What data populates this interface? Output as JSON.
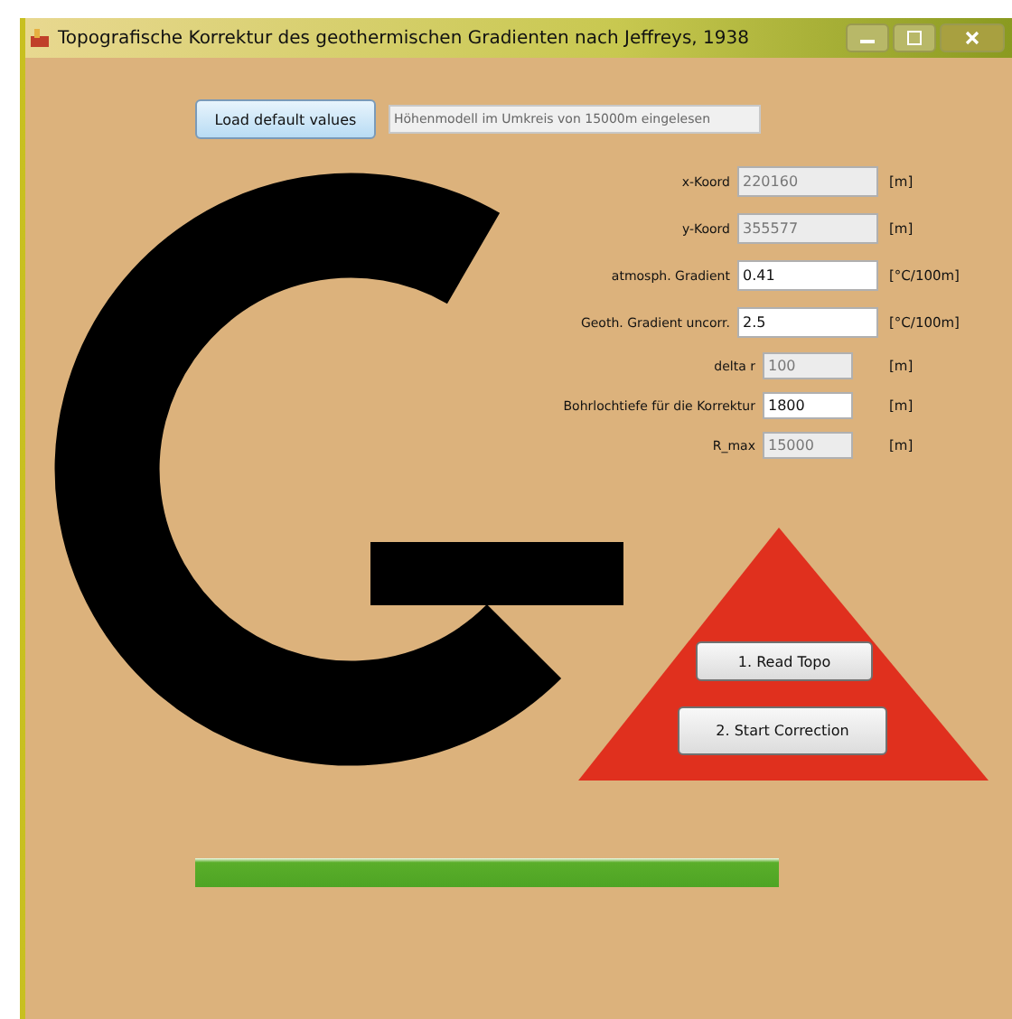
{
  "window": {
    "title": "Topografische Korrektur des geothermischen Gradienten nach Jeffreys, 1938"
  },
  "load_button": {
    "label": "Load default values"
  },
  "status_field": {
    "value": "Höhenmodell im Umkreis von 15000m eingelesen",
    "disabled": true
  },
  "fields": [
    {
      "label": "x-Koord",
      "value": "220160",
      "unit": "[m]",
      "disabled": true,
      "wide": true
    },
    {
      "label": "y-Koord",
      "value": "355577",
      "unit": "[m]",
      "disabled": true,
      "wide": true
    },
    {
      "label": "atmosph. Gradient",
      "value": "0.41",
      "unit": "[°C/100m]",
      "disabled": false,
      "wide": true
    },
    {
      "label": "Geoth. Gradient uncorr.",
      "value": "2.5",
      "unit": "[°C/100m]",
      "disabled": false,
      "wide": true
    },
    {
      "label": "delta r",
      "value": "100",
      "unit": "[m]",
      "disabled": true,
      "wide": false
    },
    {
      "label": "Bohrlochtiefe für die Korrektur",
      "value": "1800",
      "unit": "[m]",
      "disabled": false,
      "wide": false
    },
    {
      "label": "R_max",
      "value": "15000",
      "unit": "[m]",
      "disabled": true,
      "wide": false
    }
  ],
  "action_buttons": [
    {
      "label": "1. Read Topo"
    },
    {
      "label": "2. Start Correction"
    }
  ],
  "progress": {
    "level": 1.0
  }
}
